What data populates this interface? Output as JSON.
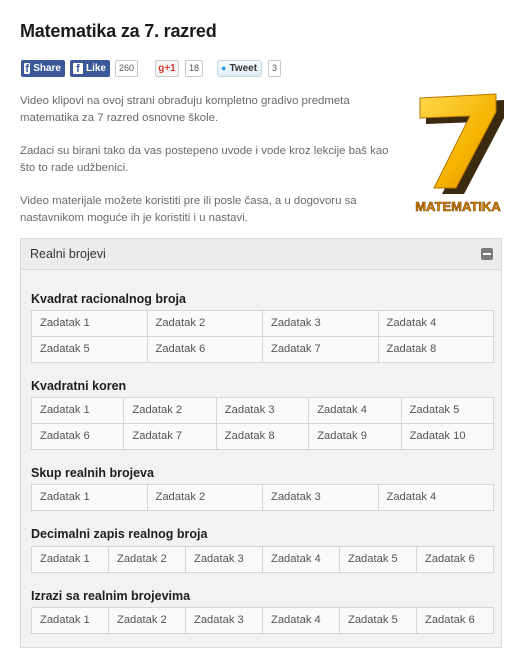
{
  "page_title": "Matematika za 7. razred",
  "social": {
    "fb_share": "Share",
    "fb_like": "Like",
    "fb_count": "260",
    "gplus": "+1",
    "gplus_count": "18",
    "tweet": "Tweet",
    "tweet_count": "3"
  },
  "intro": [
    "Video klipovi na ovoj strani obrađuju kompletno gradivo predmeta matematika za 7 razred osnovne škole.",
    "Zadaci su birani tako da vas postepeno uvode i vode kroz lekcije baš kao što to rade udžbenici.",
    "Video materijale možete koristiti pre ili posle časa, a u dogovoru sa nastavnikom moguće ih je koristiti i u nastavi."
  ],
  "logo": {
    "digit": "7",
    "word": "MATEMATIKA"
  },
  "panel": {
    "title": "Realni brojevi",
    "sections": [
      {
        "title": "Kvadrat racionalnog broja",
        "cols": 4,
        "items": [
          "Zadatak 1",
          "Zadatak 2",
          "Zadatak 3",
          "Zadatak 4",
          "Zadatak 5",
          "Zadatak 6",
          "Zadatak 7",
          "Zadatak 8"
        ]
      },
      {
        "title": "Kvadratni koren",
        "cols": 5,
        "items": [
          "Zadatak 1",
          "Zadatak 2",
          "Zadatak 3",
          "Zadatak 4",
          "Zadatak 5",
          "Zadatak 6",
          "Zadatak 7",
          "Zadatak 8",
          "Zadatak 9",
          "Zadatak 10"
        ]
      },
      {
        "title": "Skup realnih brojeva",
        "cols": 4,
        "items": [
          "Zadatak 1",
          "Zadatak 2",
          "Zadatak 3",
          "Zadatak 4"
        ]
      },
      {
        "title": "Decimalni zapis realnog broja",
        "cols": 6,
        "items": [
          "Zadatak 1",
          "Zadatak 2",
          "Zadatak 3",
          "Zadatak 4",
          "Zadatak 5",
          "Zadatak 6"
        ]
      },
      {
        "title": "Izrazi sa realnim brojevima",
        "cols": 6,
        "items": [
          "Zadatak 1",
          "Zadatak 2",
          "Zadatak 3",
          "Zadatak 4",
          "Zadatak 5",
          "Zadatak 6"
        ]
      }
    ]
  },
  "colors": {
    "fb": "#3b5998",
    "gplus": "#d73d32",
    "twitter": "#2ea0ea",
    "logo_gold": "#f5b400"
  }
}
